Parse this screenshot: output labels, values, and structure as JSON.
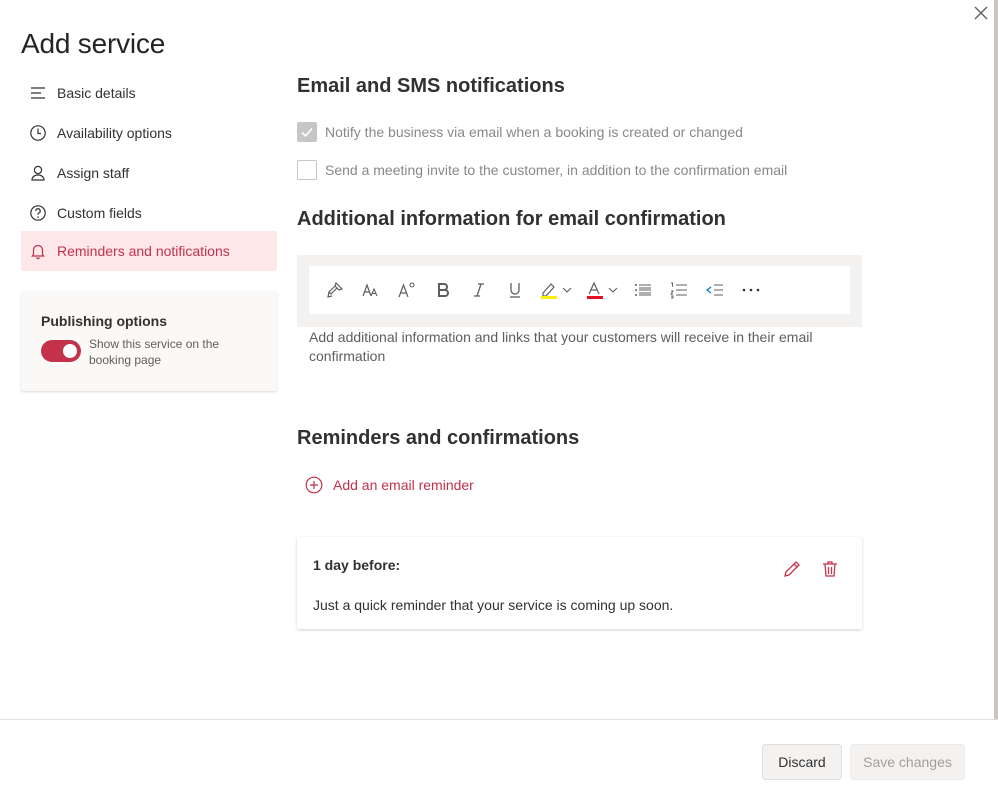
{
  "page": {
    "title": "Add service",
    "accent_color": "#c4314b"
  },
  "sidebar": {
    "items": [
      {
        "label": "Basic details",
        "icon": "list-icon"
      },
      {
        "label": "Availability options",
        "icon": "clock-icon"
      },
      {
        "label": "Assign staff",
        "icon": "person-icon"
      },
      {
        "label": "Custom fields",
        "icon": "question-icon"
      },
      {
        "label": "Reminders and notifications",
        "icon": "bell-icon",
        "active": true
      }
    ],
    "publishing": {
      "title": "Publishing options",
      "toggle_label": "Show this service on the booking page",
      "toggle_on": true
    }
  },
  "notifications": {
    "heading": "Email and SMS notifications",
    "notify_business_label": "Notify the business via email when a booking is created or changed",
    "notify_business_checked": true,
    "meeting_invite_label": "Send a meeting invite to the customer, in addition to the confirmation email",
    "meeting_invite_checked": false
  },
  "email_confirmation": {
    "heading": "Additional information for email confirmation",
    "placeholder": "Add additional information and links that your customers will receive in their email confirmation",
    "toolbar": [
      "format-painter-icon",
      "font-size-icon",
      "superscript-icon",
      "bold-icon",
      "italic-icon",
      "underline-icon",
      "highlight-icon",
      "font-color-icon",
      "bullet-list-icon",
      "numbered-list-icon",
      "outdent-icon",
      "more-icon"
    ]
  },
  "reminders": {
    "heading": "Reminders and confirmations",
    "add_label": "Add an email reminder",
    "items": [
      {
        "title": "1 day before:",
        "text": "Just a quick reminder that your service is coming up soon."
      }
    ]
  },
  "footer": {
    "discard_label": "Discard",
    "save_label": "Save changes"
  }
}
